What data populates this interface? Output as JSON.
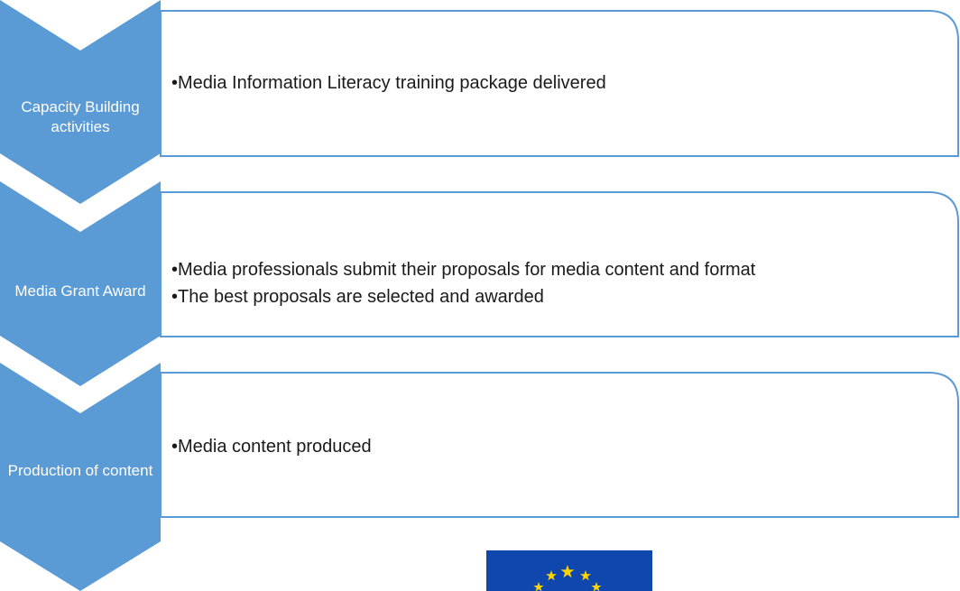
{
  "steps": [
    {
      "label": "Capacity Building activities",
      "bullets": [
        "•Media Information Literacy training package delivered"
      ]
    },
    {
      "label": "Media Grant Award",
      "bullets": [
        "•Media professionals submit their proposals for media content and format",
        "•The best proposals are selected and awarded"
      ]
    },
    {
      "label": "Production of content",
      "bullets": [
        "•Media content produced"
      ]
    }
  ],
  "colors": {
    "chevron_fill": "#5b9bd5",
    "box_stroke": "#5b9bd5",
    "box_fill": "#ffffff",
    "text": "#1a1a1a",
    "eu_flag_blue": "#0f47af",
    "eu_star": "#ffd500"
  },
  "logo": {
    "name": "eu-flag-logo"
  }
}
